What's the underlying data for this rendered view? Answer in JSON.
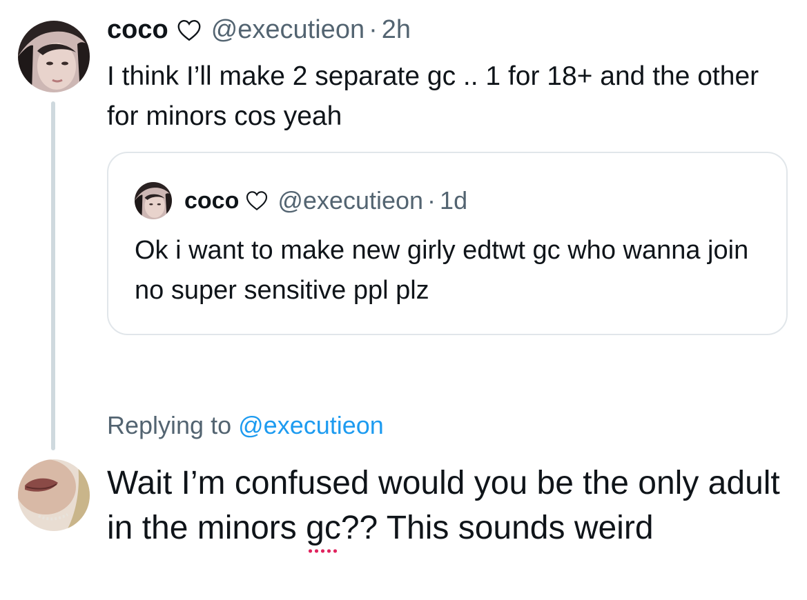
{
  "tweet": {
    "name": "coco",
    "handle": "@executieon",
    "separator": "·",
    "time": "2h",
    "text": "I think I’ll make 2 separate gc .. 1 for 18+ and the other for minors cos yeah"
  },
  "quote": {
    "name": "coco",
    "handle": "@executieon",
    "separator": "·",
    "time": "1d",
    "text": "Ok i want to make new girly edtwt gc who wanna join no super sensitive ppl plz"
  },
  "reply": {
    "replying_prefix": "Replying to",
    "replying_handle": "@executieon",
    "text_before": "Wait I’m confused would you be the only adult in the minors ",
    "text_misspelled": "gc",
    "text_after": "?? This sounds weird"
  },
  "colors": {
    "text": "#0f1419",
    "secondary": "#536471",
    "link": "#1d9bf0",
    "thread_line": "#cfd9de",
    "spellcheck": "#e0245e"
  },
  "icons": {
    "heart": "heart-outline-icon"
  }
}
